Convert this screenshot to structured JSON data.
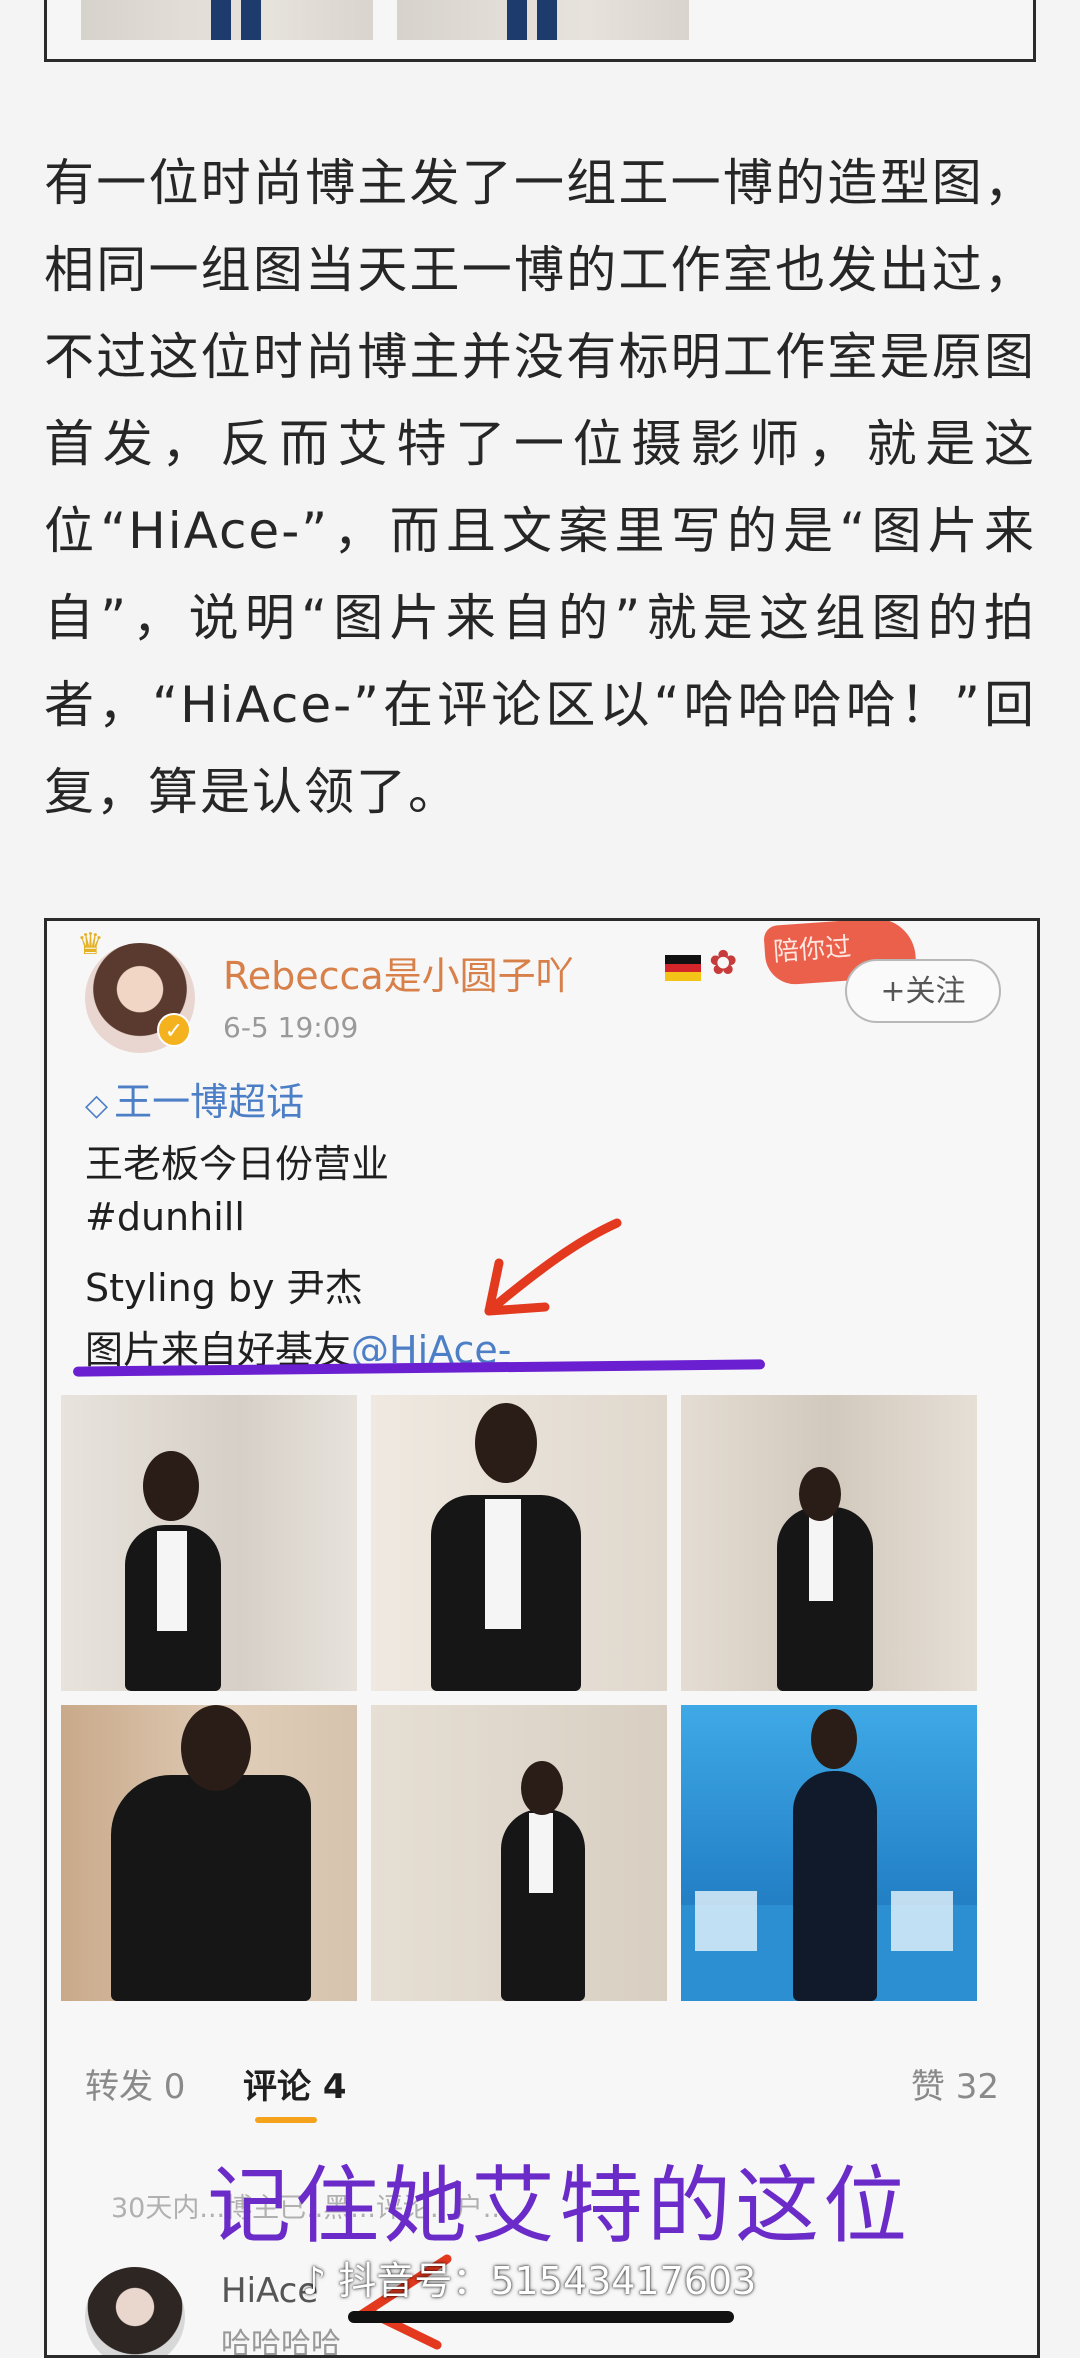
{
  "article": {
    "text": "有一位时尚博主发了一组王一博的造型图，相同一组图当天王一博的工作室也发出过，不过这位时尚博主并没有标明工作室是原图首发，反而艾特了一位摄影师，就是这位“HiAce-”，而且文案里写的是“图片来自”，说明“图片来自的”就是这组图的拍者，“HiAce-”在评论区以“哈哈哈哈！”回复，算是认领了。"
  },
  "post": {
    "username": "Rebecca是小圆子吖",
    "badge_text": "陪你过",
    "follow_label": "+关注",
    "time": "6-5 19:09",
    "topic": "王一博超话",
    "lines": [
      "王老板今日份营业",
      "#dunhill",
      "Styling by 尹杰"
    ],
    "source_prefix": "图片来自好基友",
    "mention": "@HiAce-",
    "actions": {
      "repost": "转发 0",
      "comments": "评论 4",
      "likes": "赞 32"
    },
    "notice": "30天内...博主已..黑...评论...户...",
    "overlay_text": "记住她艾特的这位",
    "commenter": {
      "name": "HiAce",
      "text": "哈哈哈哈"
    }
  },
  "watermark": {
    "label": "抖音号：51543417603"
  },
  "icons": [
    "tiktok-icon",
    "crown-icon",
    "verified-icon",
    "germany-flag-icon",
    "bear-icon",
    "super-topic-icon"
  ],
  "colors": {
    "username": "#d8804a",
    "link": "#4c7fc6",
    "overlay": "#6a2bc8",
    "tab_indicator": "#f5a21c"
  }
}
